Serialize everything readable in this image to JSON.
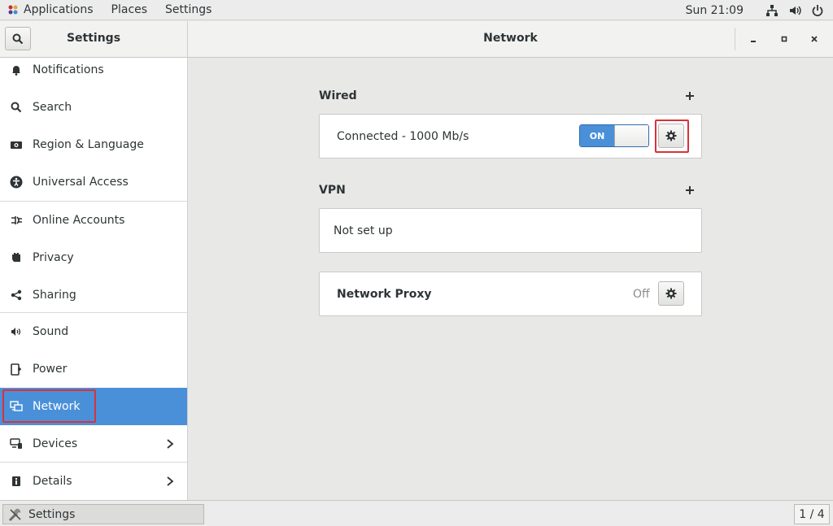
{
  "topbar": {
    "applications": "Applications",
    "places": "Places",
    "settings": "Settings",
    "clock": "Sun 21:09",
    "icons": [
      "network-icon",
      "volume-icon",
      "power-icon"
    ]
  },
  "headerbar": {
    "left_title": "Settings",
    "title": "Network"
  },
  "sidebar": {
    "items": [
      {
        "label": "Notifications",
        "icon": "bell-icon"
      },
      {
        "label": "Search",
        "icon": "search-icon"
      },
      {
        "label": "Region & Language",
        "icon": "camera-icon"
      },
      {
        "label": "Universal Access",
        "icon": "accessibility-icon"
      },
      {
        "label": "Online Accounts",
        "icon": "online-accounts-icon"
      },
      {
        "label": "Privacy",
        "icon": "hand-icon"
      },
      {
        "label": "Sharing",
        "icon": "share-icon"
      },
      {
        "label": "Sound",
        "icon": "speaker-icon"
      },
      {
        "label": "Power",
        "icon": "battery-plug-icon"
      },
      {
        "label": "Network",
        "icon": "network-icon",
        "active": true
      },
      {
        "label": "Devices",
        "icon": "devices-icon"
      },
      {
        "label": "Details",
        "icon": "info-icon"
      }
    ]
  },
  "main": {
    "wired": {
      "title": "Wired",
      "status": "Connected - 1000 Mb/s",
      "switch_label": "ON"
    },
    "vpn": {
      "title": "VPN",
      "status": "Not set up"
    },
    "proxy": {
      "title": "Network Proxy",
      "status": "Off"
    }
  },
  "taskbar": {
    "app_label": "Settings",
    "pager": "1 / 4"
  },
  "colors": {
    "accent": "#4a90d9",
    "highlight": "#d9323a"
  }
}
